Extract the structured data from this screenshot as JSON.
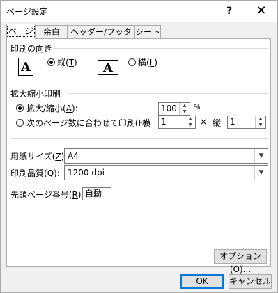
{
  "window": {
    "title": "ページ設定",
    "help_glyph": "?",
    "close_glyph": "✕"
  },
  "tabs": [
    {
      "label": "ページ",
      "active": true
    },
    {
      "label": "余白",
      "active": false
    },
    {
      "label": "ヘッダー/フッター",
      "active": false
    },
    {
      "label": "シート",
      "active": false
    }
  ],
  "orientation": {
    "label": "印刷の向き",
    "icon_letter": "A",
    "portrait_label": "縦(",
    "portrait_key": "T",
    "landscape_label": "横(",
    "landscape_key": "L",
    "close_paren": ")",
    "selected": "portrait"
  },
  "scaling": {
    "label": "拡大縮小印刷",
    "adjust_label": "拡大/縮小(",
    "adjust_key": "A",
    "adjust_suffix": "):",
    "adjust_value": "100",
    "percent": "%",
    "fit_label": "次のページ数に合わせて印刷(",
    "fit_key": "F",
    "fit_suffix": "):",
    "wide_label": "横",
    "wide_value": "1",
    "times": "×",
    "tall_label": "縦",
    "tall_value": "1",
    "selected": "adjust"
  },
  "paper_size": {
    "label": "用紙サイズ(",
    "key": "Z",
    "suffix": "):",
    "value": "A4"
  },
  "print_quality": {
    "label": "印刷品質(",
    "key": "Q",
    "suffix": "):",
    "value": "1200 dpi"
  },
  "first_page": {
    "label": "先頭ページ番号(",
    "key": "R",
    "suffix": "):",
    "value": "自動"
  },
  "buttons": {
    "options": "オプション(O)...",
    "ok": "OK",
    "cancel": "キャンセル"
  },
  "colors": {
    "accent": "#0078d7"
  }
}
